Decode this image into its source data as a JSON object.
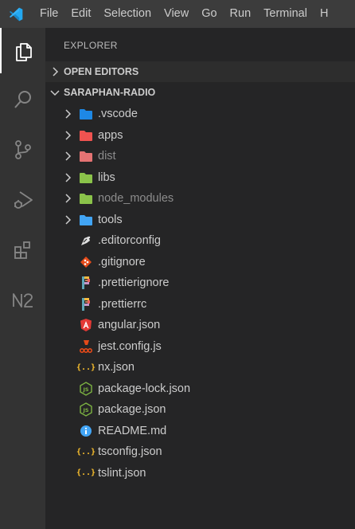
{
  "menu": [
    "File",
    "Edit",
    "Selection",
    "View",
    "Go",
    "Run",
    "Terminal",
    "H"
  ],
  "sidebar": {
    "title": "EXPLORER",
    "open_editors": "OPEN EDITORS",
    "workspace": "SARAPHAN-RADIO"
  },
  "tree": [
    {
      "label": ".vscode",
      "type": "folder",
      "icon": "folder-vscode-icon",
      "color": "#1e88e5"
    },
    {
      "label": "apps",
      "type": "folder",
      "icon": "folder-apps-icon",
      "color": "#ef5350"
    },
    {
      "label": "dist",
      "type": "folder",
      "icon": "folder-dist-icon",
      "color": "#e57373",
      "dim": true
    },
    {
      "label": "libs",
      "type": "folder",
      "icon": "folder-libs-icon",
      "color": "#8bc34a"
    },
    {
      "label": "node_modules",
      "type": "folder",
      "icon": "folder-node-icon",
      "color": "#8bc34a",
      "dim": true
    },
    {
      "label": "tools",
      "type": "folder",
      "icon": "folder-tools-icon",
      "color": "#42a5f5"
    },
    {
      "label": ".editorconfig",
      "type": "file",
      "icon": "editorconfig-icon",
      "color": "#e0e0e0"
    },
    {
      "label": ".gitignore",
      "type": "file",
      "icon": "git-icon",
      "color": "#e64a19"
    },
    {
      "label": ".prettierignore",
      "type": "file",
      "icon": "prettier-icon",
      "color": "#c0845a"
    },
    {
      "label": ".prettierrc",
      "type": "file",
      "icon": "prettier-icon",
      "color": "#c0845a"
    },
    {
      "label": "angular.json",
      "type": "file",
      "icon": "angular-icon",
      "color": "#e53935"
    },
    {
      "label": "jest.config.js",
      "type": "file",
      "icon": "jest-icon",
      "color": "#e64a19"
    },
    {
      "label": "nx.json",
      "type": "file",
      "icon": "json-icon",
      "color": "#fbc02d"
    },
    {
      "label": "package-lock.json",
      "type": "file",
      "icon": "nodejs-icon",
      "color": "#7cb342"
    },
    {
      "label": "package.json",
      "type": "file",
      "icon": "nodejs-icon",
      "color": "#7cb342"
    },
    {
      "label": "README.md",
      "type": "file",
      "icon": "info-icon",
      "color": "#42a5f5"
    },
    {
      "label": "tsconfig.json",
      "type": "file",
      "icon": "json-icon",
      "color": "#fbc02d"
    },
    {
      "label": "tslint.json",
      "type": "file",
      "icon": "json-icon",
      "color": "#fbc02d"
    }
  ]
}
